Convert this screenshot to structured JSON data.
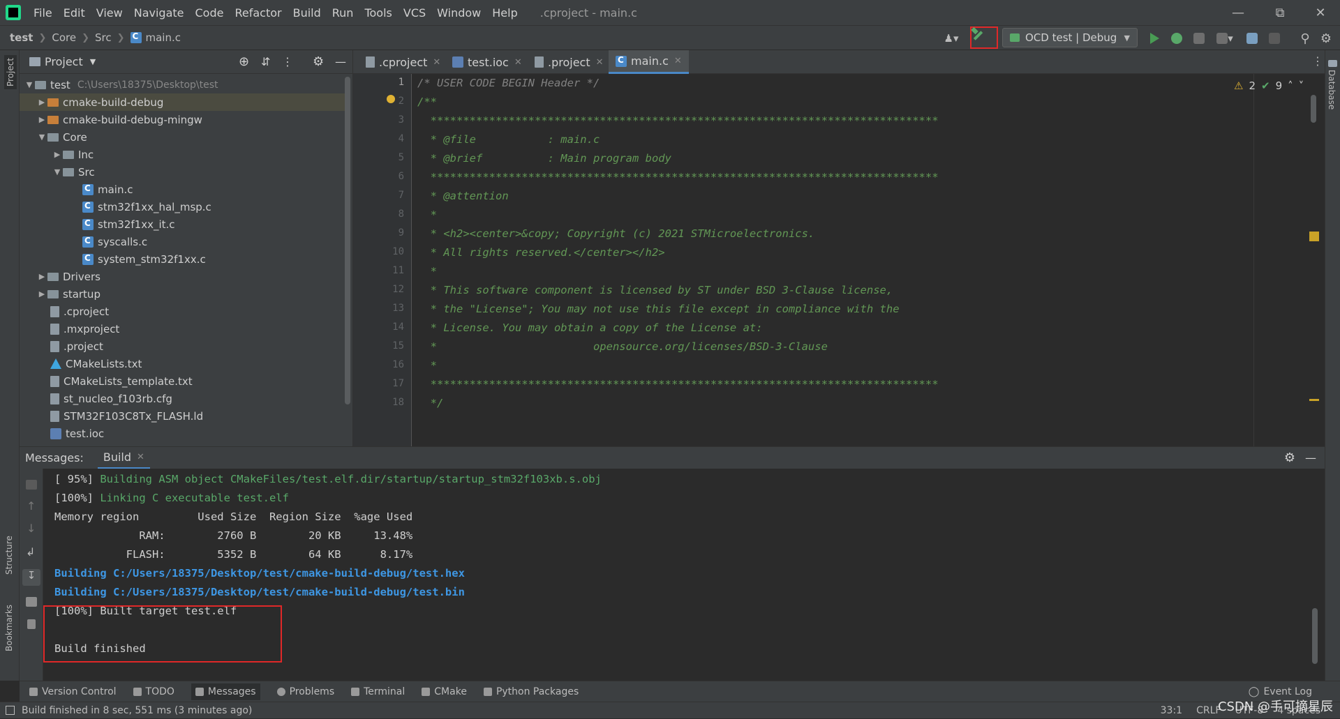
{
  "menubar": {
    "items": [
      "File",
      "Edit",
      "View",
      "Navigate",
      "Code",
      "Refactor",
      "Build",
      "Run",
      "Tools",
      "VCS",
      "Window",
      "Help"
    ],
    "window_title": ".cproject - main.c"
  },
  "breadcrumbs": [
    "test",
    "Core",
    "Src",
    "main.c"
  ],
  "toolbar": {
    "run_config": "OCD test | Debug"
  },
  "project": {
    "title": "Project",
    "tree": [
      {
        "label": "test",
        "hint": "C:\\Users\\18375\\Desktop\\test",
        "icon": "folder-icon"
      },
      {
        "label": "cmake-build-debug",
        "icon": "folder-orange-icon"
      },
      {
        "label": "cmake-build-debug-mingw",
        "icon": "folder-orange-icon"
      },
      {
        "label": "Core",
        "icon": "folder-icon"
      },
      {
        "label": "Inc",
        "icon": "folder-icon"
      },
      {
        "label": "Src",
        "icon": "folder-icon"
      },
      {
        "label": "main.c",
        "icon": "c-file-icon"
      },
      {
        "label": "stm32f1xx_hal_msp.c",
        "icon": "c-file-icon"
      },
      {
        "label": "stm32f1xx_it.c",
        "icon": "c-file-icon"
      },
      {
        "label": "syscalls.c",
        "icon": "c-file-icon"
      },
      {
        "label": "system_stm32f1xx.c",
        "icon": "c-file-icon"
      },
      {
        "label": "Drivers",
        "icon": "folder-icon"
      },
      {
        "label": "startup",
        "icon": "folder-icon"
      },
      {
        "label": ".cproject",
        "icon": "file-icon"
      },
      {
        "label": ".mxproject",
        "icon": "file-icon"
      },
      {
        "label": ".project",
        "icon": "file-icon"
      },
      {
        "label": "CMakeLists.txt",
        "icon": "cmake-icon"
      },
      {
        "label": "CMakeLists_template.txt",
        "icon": "file-icon"
      },
      {
        "label": "st_nucleo_f103rb.cfg",
        "icon": "file-icon"
      },
      {
        "label": "STM32F103C8Tx_FLASH.ld",
        "icon": "file-icon"
      },
      {
        "label": "test.ioc",
        "icon": "ioc-icon"
      }
    ]
  },
  "editor": {
    "tabs": [
      ".cproject",
      "test.ioc",
      ".project",
      "main.c"
    ],
    "inspections": {
      "warnings": "2",
      "ok": "9"
    },
    "line_numbers": [
      "1",
      "2",
      "3",
      "4",
      "5",
      "6",
      "7",
      "8",
      "9",
      "10",
      "11",
      "12",
      "13",
      "14",
      "15",
      "16",
      "17",
      "18"
    ],
    "lines": [
      "/* USER CODE BEGIN Header */",
      "/**",
      "  ******************************************************************************",
      "  * @file           : main.c",
      "  * @brief          : Main program body",
      "  ******************************************************************************",
      "  * @attention",
      "  *",
      "  * <h2><center>&copy; Copyright (c) 2021 STMicroelectronics.",
      "  * All rights reserved.</center></h2>",
      "  *",
      "  * This software component is licensed by ST under BSD 3-Clause license,",
      "  * the \"License\"; You may not use this file except in compliance with the",
      "  * License. You may obtain a copy of the License at:",
      "  *                        opensource.org/licenses/BSD-3-Clause",
      "  *",
      "  ******************************************************************************",
      "  */"
    ]
  },
  "messages": {
    "label": "Messages:",
    "tab": "Build",
    "console": {
      "l1_prefix": "[ 95%] ",
      "l1_text": "Building ASM object CMakeFiles/test.elf.dir/startup/startup_stm32f103xb.s.obj",
      "l2_prefix": "[100%] ",
      "l2_text": "Linking C executable test.elf",
      "l3": "Memory region         Used Size  Region Size  %age Used",
      "l4": "             RAM:        2760 B        20 KB     13.48%",
      "l5": "           FLASH:        5352 B        64 KB      8.17%",
      "l6": "Building C:/Users/18375/Desktop/test/cmake-build-debug/test.hex",
      "l7": "Building C:/Users/18375/Desktop/test/cmake-build-debug/test.bin",
      "l8": "[100%] Built target test.elf",
      "l9": "Build finished"
    }
  },
  "bottom_tools": [
    "Version Control",
    "TODO",
    "Messages",
    "Problems",
    "Terminal",
    "CMake",
    "Python Packages"
  ],
  "side": {
    "project": "Project",
    "structure": "Structure",
    "bookmarks": "Bookmarks",
    "database": "Database"
  },
  "status": {
    "message": "Build finished in 8 sec, 551 ms (3 minutes ago)",
    "position": "33:1",
    "line_sep": "CRLF",
    "encoding": "UTF-8",
    "indent": "4 spaces",
    "event_log": "Event Log",
    "watermark": "CSDN @手可摘星辰"
  },
  "colors": {
    "accent": "#4a88c7",
    "highlight": "#e02828",
    "run": "#499c54"
  }
}
